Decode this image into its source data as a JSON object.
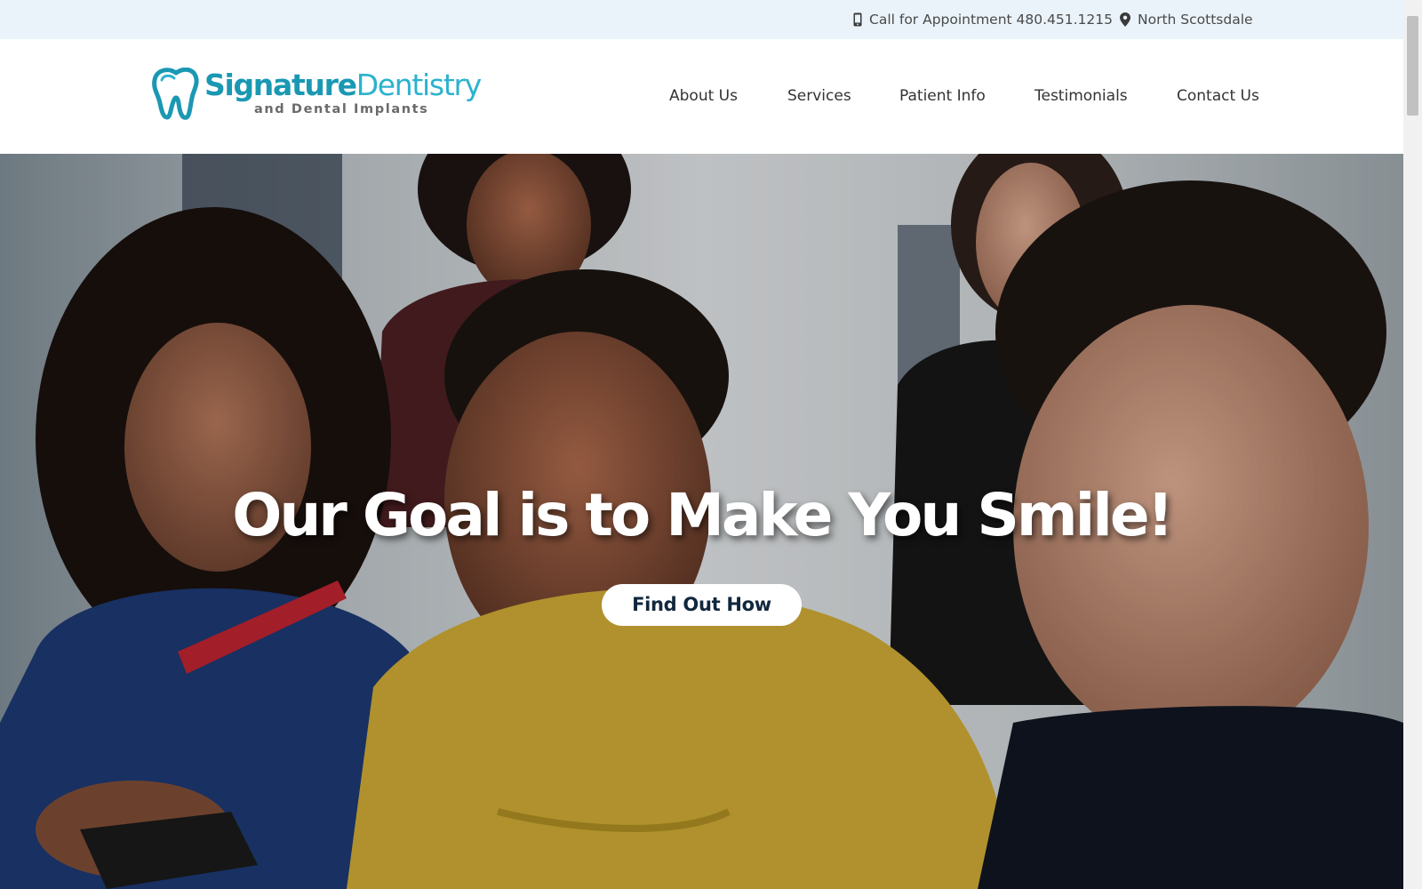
{
  "topbar": {
    "phone_text": "Call for Appointment 480.451.1215",
    "location_text": "North Scottsdale",
    "phone_icon": "mobile-phone-icon",
    "location_icon": "map-marker-icon"
  },
  "logo": {
    "name_part1": "Signature",
    "name_part2": "Dentistry",
    "tagline": "and Dental Implants",
    "icon": "tooth-icon"
  },
  "nav": {
    "items": [
      {
        "label": "About Us"
      },
      {
        "label": "Services"
      },
      {
        "label": "Patient Info"
      },
      {
        "label": "Testimonials"
      },
      {
        "label": "Contact Us"
      }
    ]
  },
  "hero": {
    "title": "Our Goal is to Make You Smile!",
    "button_label": "Find Out How"
  },
  "colors": {
    "topbar_bg": "#eaf3fa",
    "brand_primary": "#1a98b3",
    "brand_light": "#2bb2cf",
    "button_text": "#12273d",
    "nav_text": "#333333"
  }
}
